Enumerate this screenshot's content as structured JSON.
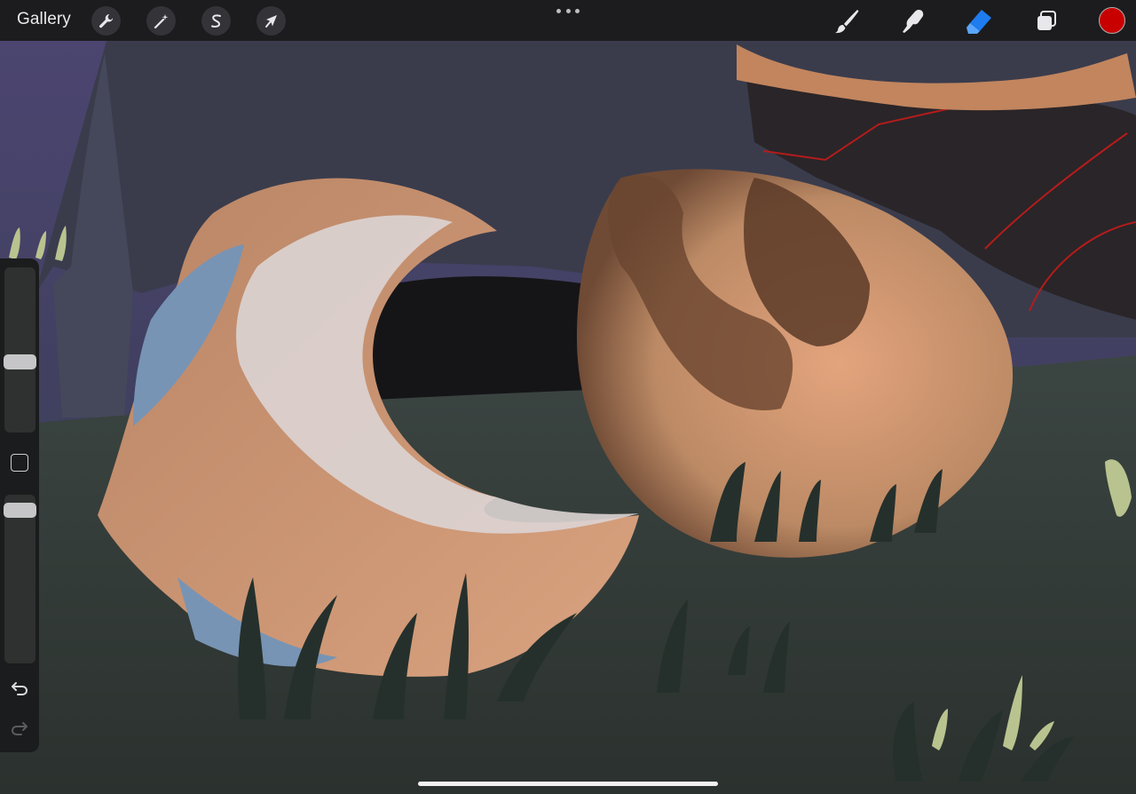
{
  "topbar": {
    "gallery_label": "Gallery",
    "left_tools": [
      {
        "name": "actions",
        "icon": "wrench-icon"
      },
      {
        "name": "adjustments",
        "icon": "magic-wand-icon"
      },
      {
        "name": "selection",
        "icon": "selection-s-icon"
      },
      {
        "name": "transform",
        "icon": "arrow-cursor-icon"
      }
    ],
    "right_tools": [
      {
        "name": "brush",
        "icon": "brush-icon",
        "active": false
      },
      {
        "name": "smudge",
        "icon": "smudge-finger-icon",
        "active": false
      },
      {
        "name": "eraser",
        "icon": "eraser-icon",
        "active": true
      },
      {
        "name": "layers",
        "icon": "layers-icon",
        "active": false
      }
    ],
    "current_color": "#c80000"
  },
  "sidebar": {
    "brush_size_level": 0.42,
    "opacity_level": 0.05,
    "modify_icon": "square-icon",
    "undo_icon": "undo-icon",
    "redo_icon": "redo-icon"
  },
  "colors": {
    "accent_active_tool": "#1e7cf0",
    "toolbar_bg": "#1c1c1e"
  }
}
